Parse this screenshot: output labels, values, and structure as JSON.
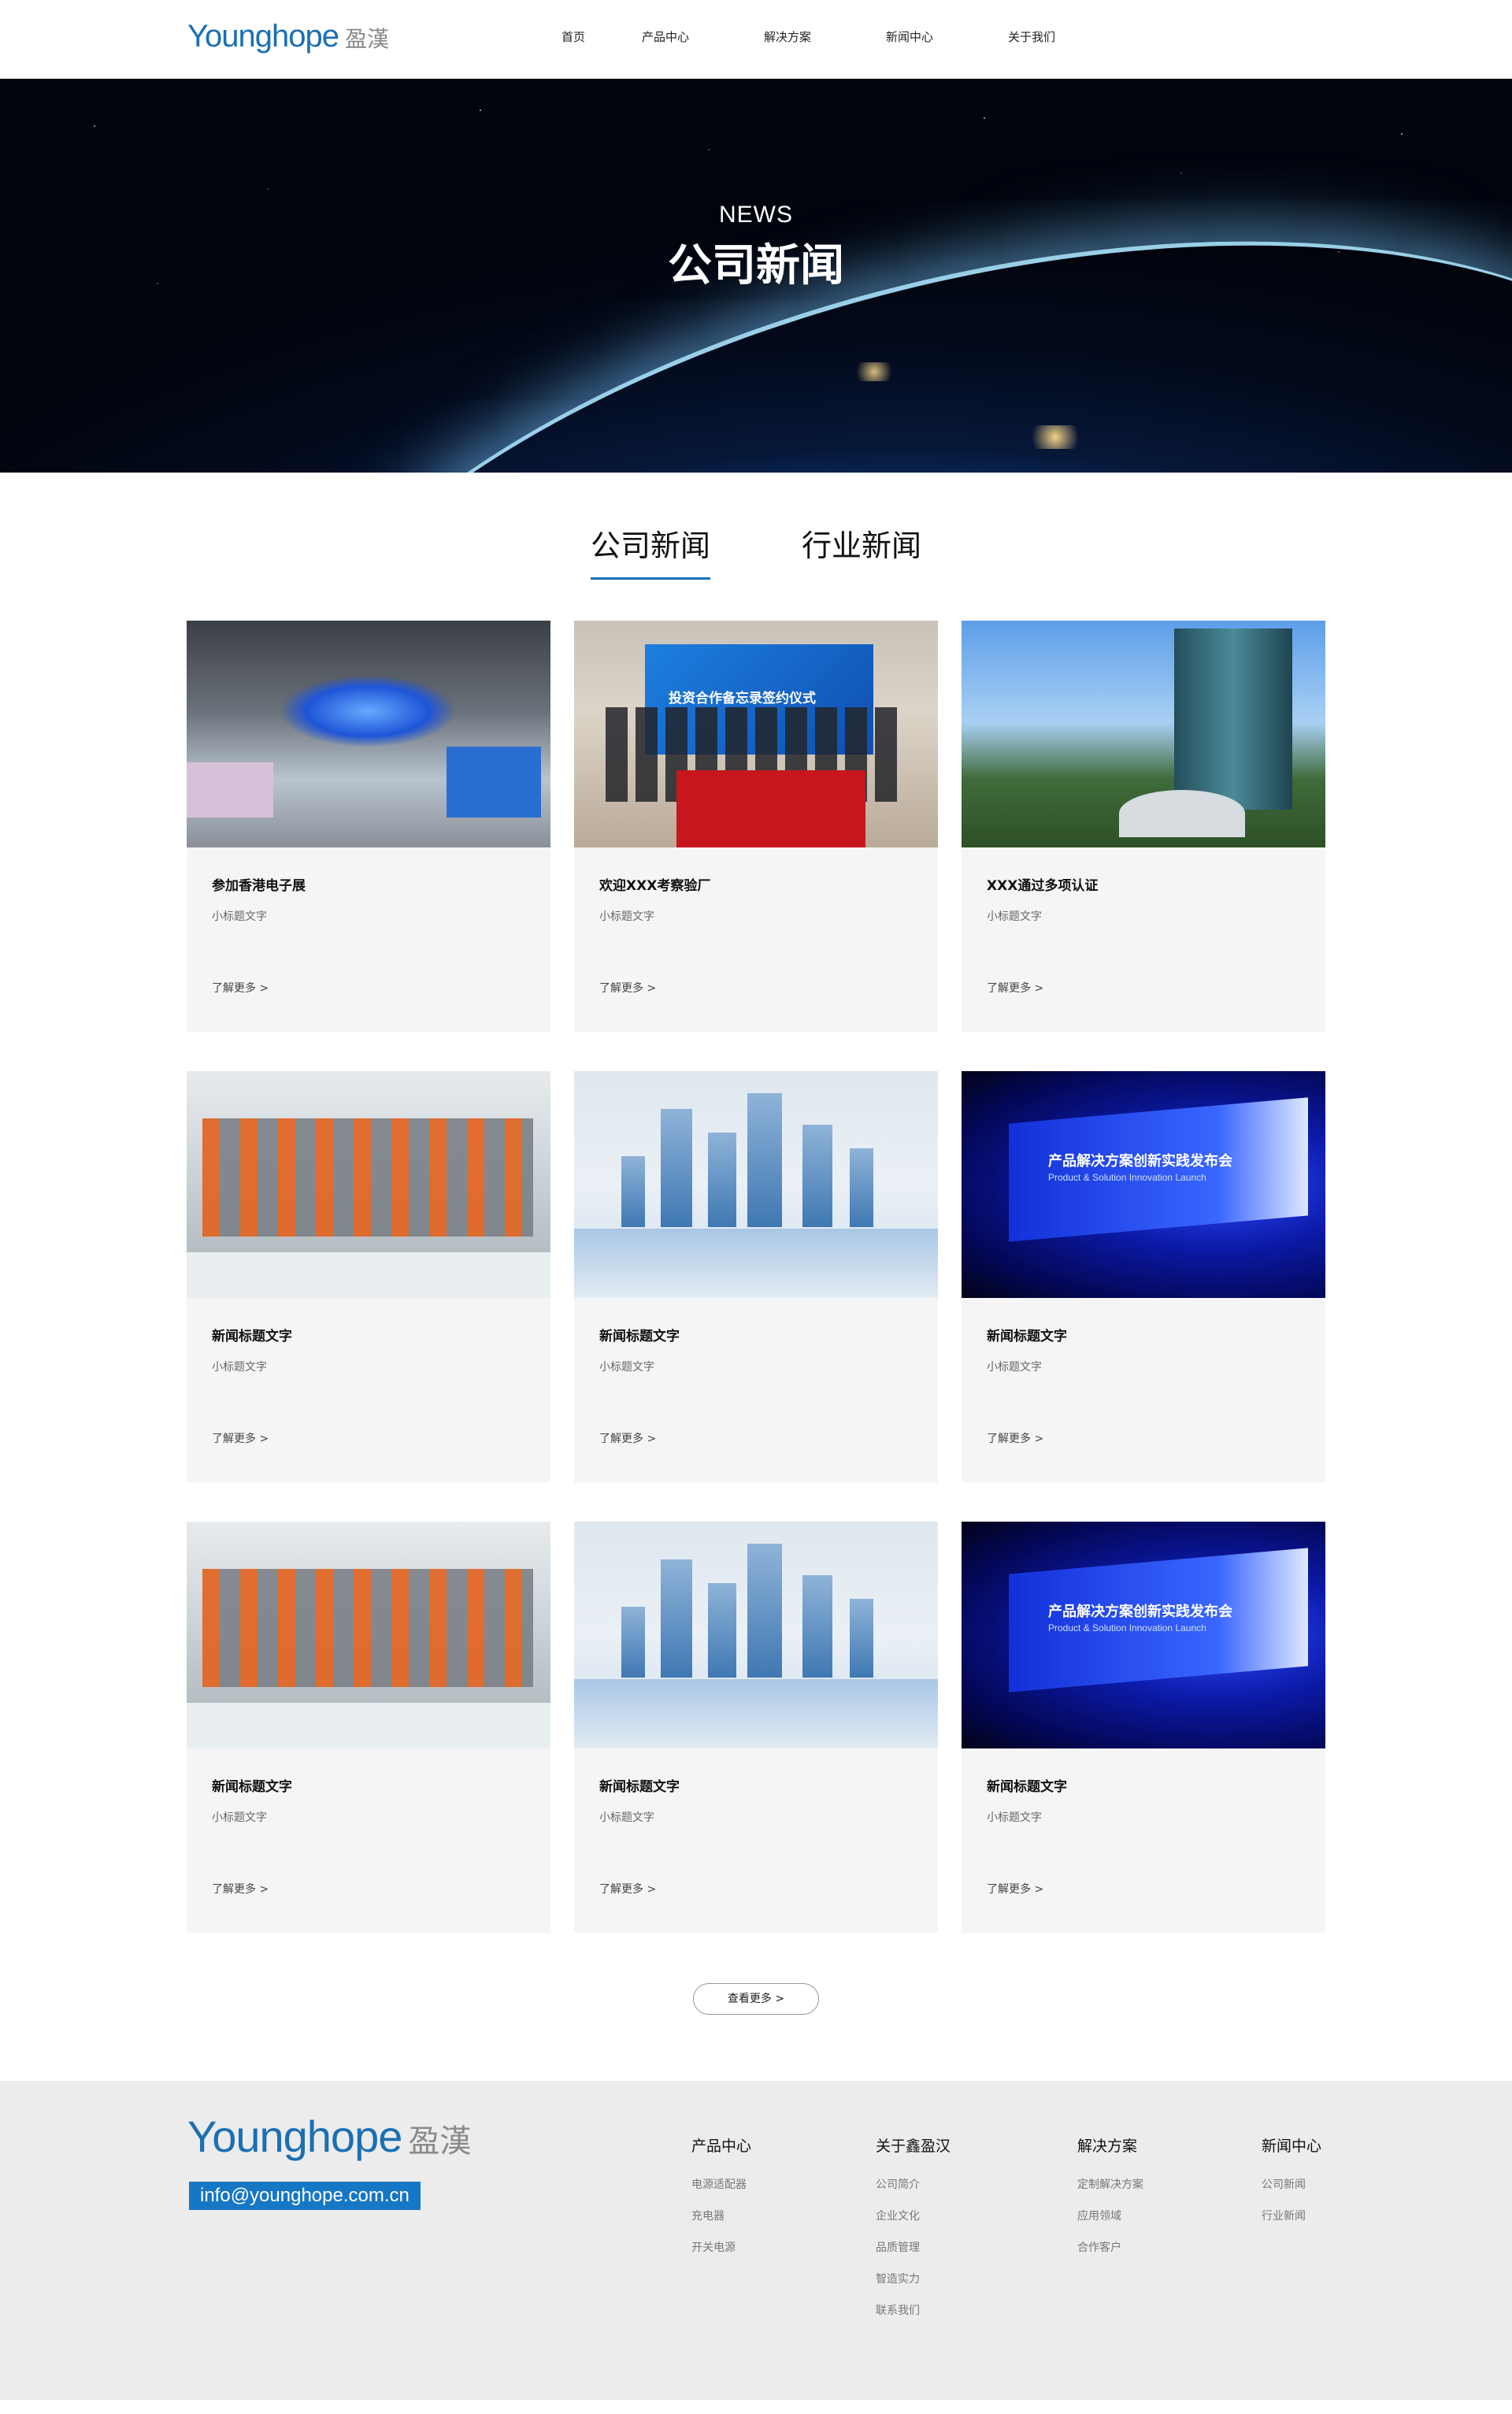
{
  "header": {
    "logo_en": "Younghope",
    "logo_cn": "盈漢",
    "nav": [
      "首页",
      "产品中心",
      "解决方案",
      "新闻中心",
      "关于我们"
    ]
  },
  "banner": {
    "subtitle": "NEWS",
    "title": "公司新闻"
  },
  "tabs": [
    {
      "label": "公司新闻",
      "active": true
    },
    {
      "label": "行业新闻",
      "active": false
    }
  ],
  "cards": [
    {
      "image": "expo-hall",
      "title": "参加香港电子展",
      "subtitle": "小标题文字",
      "more": "了解更多 >"
    },
    {
      "image": "signing-ceremony",
      "title": "欢迎XXX考察验厂",
      "subtitle": "小标题文字",
      "more": "了解更多 >",
      "image_text": "投资合作备忘录签约仪式"
    },
    {
      "image": "office-tower",
      "title": "XXX通过多项认证",
      "subtitle": "小标题文字",
      "more": "了解更多 >"
    },
    {
      "image": "factory-robots",
      "title": "新闻标题文字",
      "subtitle": "小标题文字",
      "more": "了解更多 >"
    },
    {
      "image": "city-skyline",
      "title": "新闻标题文字",
      "subtitle": "小标题文字",
      "more": "了解更多 >"
    },
    {
      "image": "launch-stage",
      "title": "新闻标题文字",
      "subtitle": "小标题文字",
      "more": "了解更多 >",
      "image_text": "产品解决方案创新实践发布会",
      "image_subtext": "Product & Solution Innovation Launch"
    },
    {
      "image": "factory-robots",
      "title": "新闻标题文字",
      "subtitle": "小标题文字",
      "more": "了解更多 >"
    },
    {
      "image": "city-skyline",
      "title": "新闻标题文字",
      "subtitle": "小标题文字",
      "more": "了解更多 >"
    },
    {
      "image": "launch-stage",
      "title": "新闻标题文字",
      "subtitle": "小标题文字",
      "more": "了解更多 >",
      "image_text": "产品解决方案创新实践发布会",
      "image_subtext": "Product & Solution Innovation Launch"
    }
  ],
  "more_button": "查看更多 >",
  "footer": {
    "logo_en": "Younghope",
    "logo_cn": "盈漢",
    "email": "info@younghope.com.cn",
    "columns": [
      {
        "title": "产品中心",
        "links": [
          "电源适配器",
          "充电器",
          "开关电源"
        ]
      },
      {
        "title": "关于鑫盈汉",
        "links": [
          "公司简介",
          "企业文化",
          "品质管理",
          "智造实力",
          "联系我们"
        ]
      },
      {
        "title": "解决方案",
        "links": [
          "定制解决方案",
          "应用领域",
          "合作客户"
        ]
      },
      {
        "title": "新闻中心",
        "links": [
          "公司新闻",
          "行业新闻"
        ]
      }
    ]
  },
  "colors": {
    "brand": "#1b6fb4",
    "email_bg": "#1677c5",
    "card_bg": "#f5f5f5",
    "footer_bg": "#ececec"
  }
}
